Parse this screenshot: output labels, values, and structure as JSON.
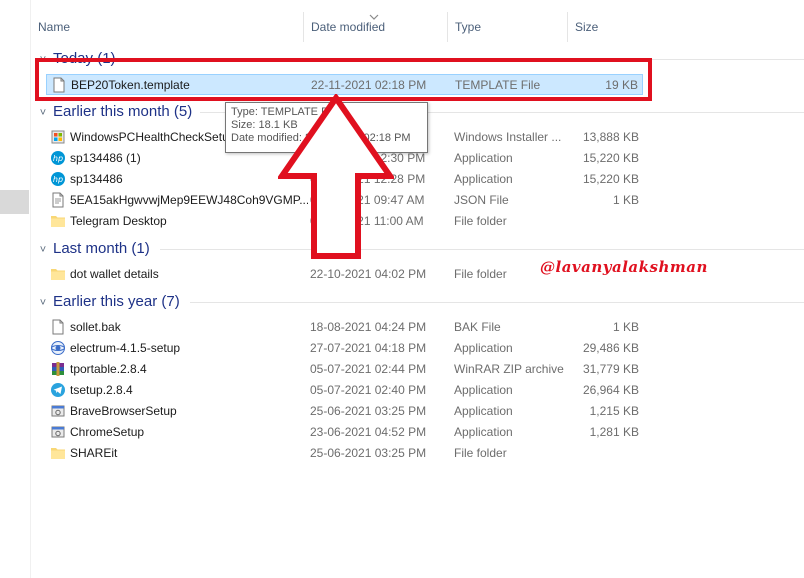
{
  "columns": {
    "name": "Name",
    "date_modified": "Date modified",
    "type": "Type",
    "size": "Size"
  },
  "groups": [
    {
      "label": "Today (1)",
      "files": [
        {
          "name": "BEP20Token.template",
          "date": "22-11-2021 02:18 PM",
          "type": "TEMPLATE File",
          "size": "19 KB",
          "icon": "blank-file-icon",
          "selected": true
        }
      ]
    },
    {
      "label": "Earlier this month (5)",
      "files": [
        {
          "name": "WindowsPCHealthCheckSetup",
          "date": "22-11-2021 02:18 PM",
          "type": "Windows Installer ...",
          "size": "13,888 KB",
          "icon": "installer-icon"
        },
        {
          "name": "sp134486 (1)",
          "date": "05-11-2021 12:30 PM",
          "type": "Application",
          "size": "15,220 KB",
          "icon": "hp-icon"
        },
        {
          "name": "sp134486",
          "date": "05-11-2021 12:28 PM",
          "type": "Application",
          "size": "15,220 KB",
          "icon": "hp-icon"
        },
        {
          "name": "5EA15akHgwvwjMep9EEWJ48Coh9VGMP...",
          "date": "05-11-2021 09:47 AM",
          "type": "JSON File",
          "size": "1 KB",
          "icon": "json-file-icon"
        },
        {
          "name": "Telegram Desktop",
          "date": "07-11-2021 11:00 AM",
          "type": "File folder",
          "size": "",
          "icon": "folder-icon"
        }
      ]
    },
    {
      "label": "Last month (1)",
      "files": [
        {
          "name": "dot wallet details",
          "date": "22-10-2021 04:02 PM",
          "type": "File folder",
          "size": "",
          "icon": "folder-icon"
        }
      ]
    },
    {
      "label": "Earlier this year (7)",
      "files": [
        {
          "name": "sollet.bak",
          "date": "18-08-2021 04:24 PM",
          "type": "BAK File",
          "size": "1 KB",
          "icon": "blank-file-icon"
        },
        {
          "name": "electrum-4.1.5-setup",
          "date": "27-07-2021 04:18 PM",
          "type": "Application",
          "size": "29,486 KB",
          "icon": "electrum-icon"
        },
        {
          "name": "tportable.2.8.4",
          "date": "05-07-2021 02:44 PM",
          "type": "WinRAR ZIP archive",
          "size": "31,779 KB",
          "icon": "winrar-icon"
        },
        {
          "name": "tsetup.2.8.4",
          "date": "05-07-2021 02:40 PM",
          "type": "Application",
          "size": "26,964 KB",
          "icon": "telegram-icon"
        },
        {
          "name": "BraveBrowserSetup",
          "date": "25-06-2021 03:25 PM",
          "type": "Application",
          "size": "1,215 KB",
          "icon": "app-setup-icon"
        },
        {
          "name": "ChromeSetup",
          "date": "23-06-2021 04:52 PM",
          "type": "Application",
          "size": "1,281 KB",
          "icon": "app-setup-icon"
        },
        {
          "name": "SHAREit",
          "date": "25-06-2021 03:25 PM",
          "type": "File folder",
          "size": "",
          "icon": "folder-icon"
        }
      ]
    }
  ],
  "tooltip": {
    "line1": "Type: TEMPLATE File",
    "line2": "Size: 18.1 KB",
    "line3": "Date modified: 22-11-2021 02:18 PM"
  },
  "watermark": "@lavanyalakshman",
  "colors": {
    "selection_bg": "#cce8ff",
    "group_heading": "#1e3287",
    "annotation_red": "#e0101f"
  }
}
